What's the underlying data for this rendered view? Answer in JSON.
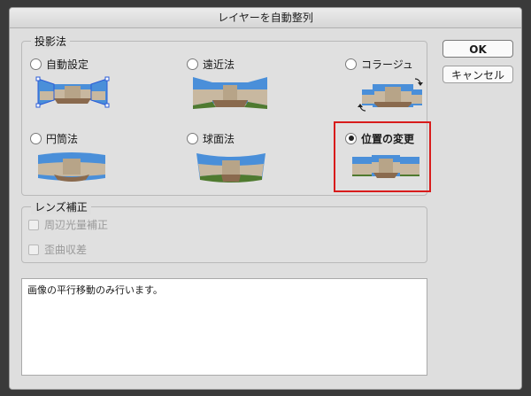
{
  "dialog": {
    "title": "レイヤーを自動整列"
  },
  "projection": {
    "legend": "投影法",
    "options": [
      {
        "label": "自動設定",
        "checked": false
      },
      {
        "label": "遠近法",
        "checked": false
      },
      {
        "label": "コラージュ",
        "checked": false
      },
      {
        "label": "円筒法",
        "checked": false
      },
      {
        "label": "球面法",
        "checked": false
      },
      {
        "label": "位置の変更",
        "checked": true
      }
    ]
  },
  "lens": {
    "legend": "レンズ補正",
    "vignette_label": "周辺光量補正",
    "distortion_label": "歪曲収差"
  },
  "description": "画像の平行移動のみ行います。",
  "buttons": {
    "ok_label": "OK",
    "cancel_label": "キャンセル"
  },
  "colors": {
    "highlight": "#d81b1b",
    "sky": "#4a8fd9",
    "grass": "#4f7a2f",
    "building": "#c8b8a0",
    "path": "#8a6a4e"
  }
}
